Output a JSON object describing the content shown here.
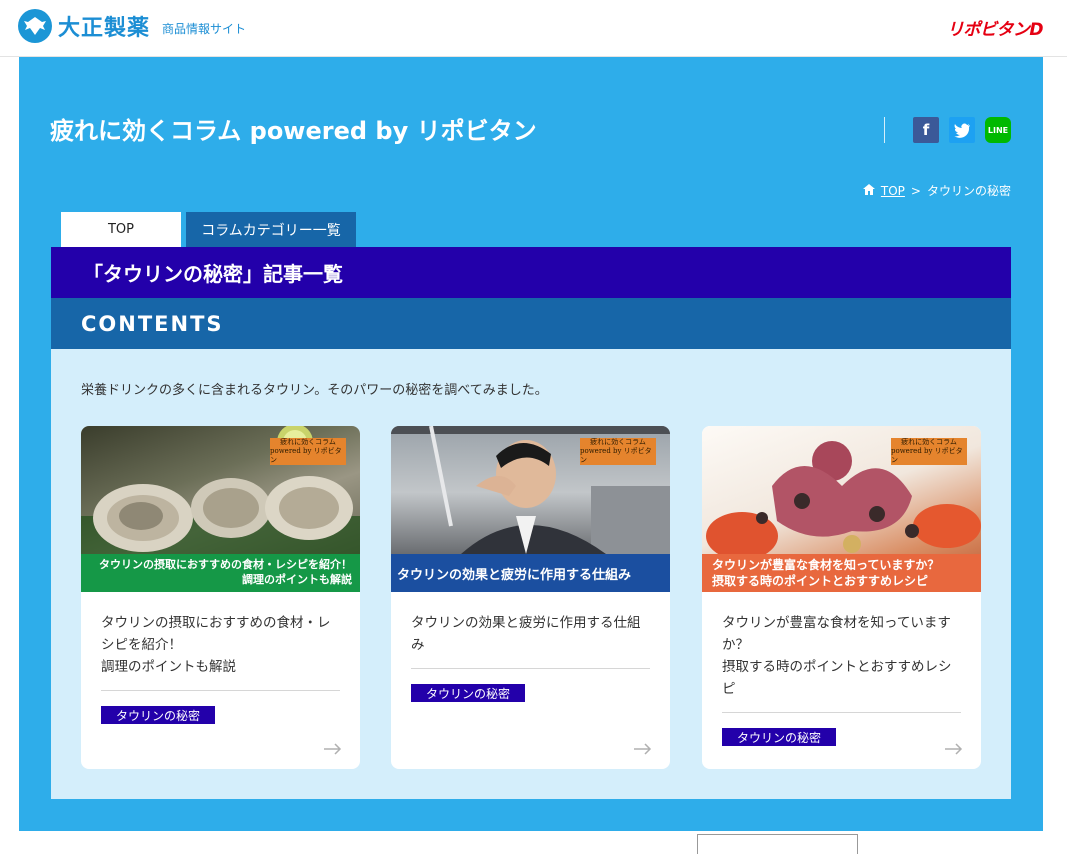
{
  "header": {
    "logo_text": "大正製薬",
    "logo_sub": "商品情報サイト",
    "brand_right": "リポビタンD"
  },
  "site": {
    "title": "疲れに効くコラム powered by リポビタン"
  },
  "share": {
    "fb": "f",
    "tw": "t",
    "line": "LINE"
  },
  "breadcrumb": {
    "home": "TOP",
    "separator": ">",
    "current": "タウリンの秘密"
  },
  "tabs": [
    {
      "label": "TOP"
    },
    {
      "label": "コラムカテゴリー一覧"
    }
  ],
  "panel": {
    "heading": "「タウリンの秘密」記事一覧",
    "contents_label": "CONTENTS",
    "intro": "栄養ドリンクの多くに含まれるタウリン。そのパワーの秘密を調べてみました。"
  },
  "cards": [
    {
      "badge_top": "疲れに効くコラム",
      "badge_bottom": "powered by リポビタン",
      "caption": "タウリンの摂取におすすめの食材・レシピを紹介！\n調理のポイントも解説",
      "title": "タウリンの摂取におすすめの食材・レ\nシピを紹介！\n調理のポイントも解説",
      "tag": "タウリンの秘密"
    },
    {
      "badge_top": "疲れに効くコラム",
      "badge_bottom": "powered by リポビタン",
      "caption": "タウリンの効果と疲労に作用する仕組み",
      "title": "タウリンの効果と疲労に作用する仕組\nみ",
      "tag": "タウリンの秘密"
    },
    {
      "badge_top": "疲れに効くコラム",
      "badge_bottom": "powered by リポビタン",
      "caption": "タウリンが豊富な食材を知っていますか？\n摂取する時のポイントとおすすめレシピ",
      "title": "タウリンが豊富な食材を知っています\nか？\n摂取する時のポイントとおすすめレシ\nピ",
      "tag": "タウリンの秘密"
    }
  ],
  "colors": {
    "main_bg": "#2eadea",
    "panel_header": "#2300aa",
    "contents_bar": "#1766a8",
    "panel_bg": "#d4eefb"
  }
}
